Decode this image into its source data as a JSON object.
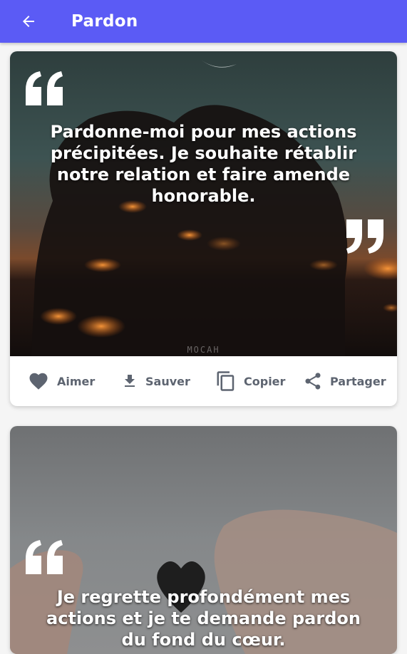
{
  "header": {
    "title": "Pardon"
  },
  "cards": [
    {
      "quote": "Pardonne-moi pour mes actions précipitées. Je souhaite rétablir notre relation et faire amende honorable.",
      "watermark": "MOCAH",
      "actions": {
        "like": "Aimer",
        "save": "Sauver",
        "copy": "Copier",
        "share": "Partager"
      }
    },
    {
      "quote": "Je regrette profondément mes actions et je te demande pardon du fond du cœur."
    }
  ],
  "colors": {
    "appbar": "#5b5bf5",
    "action_icon": "#5d6470"
  }
}
